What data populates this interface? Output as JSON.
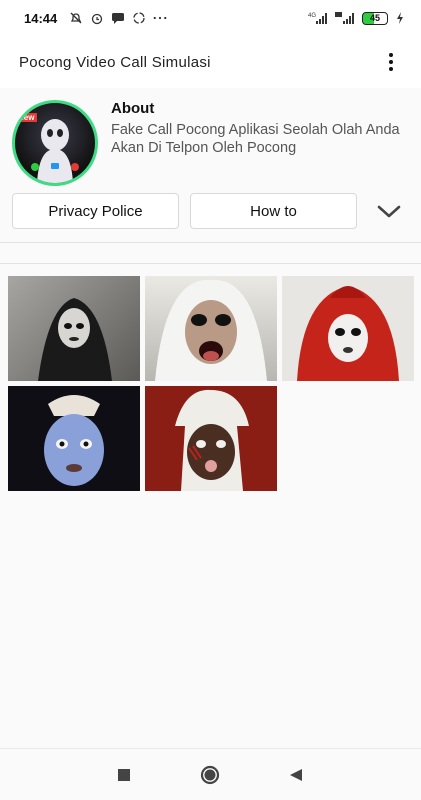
{
  "status": {
    "time": "14:44",
    "battery": "45",
    "network_label": "4G"
  },
  "appbar": {
    "title": "Pocong Video Call Simulasi",
    "menu_icon": "kebab-menu-icon"
  },
  "about": {
    "title": "About",
    "description": "Fake Call Pocong Aplikasi Seolah Olah Anda Akan Di Telpon Oleh Pocong",
    "avatar_badge": "New"
  },
  "buttons": {
    "privacy": "Privacy Police",
    "howto": "How to",
    "expand_icon": "chevron-down-icon"
  },
  "gallery": {
    "items": [
      {
        "name": "pocong-video-1",
        "bg": "#8c8a86"
      },
      {
        "name": "pocong-video-2",
        "bg": "#d9d7d2"
      },
      {
        "name": "pocong-video-3",
        "bg": "#b51d14"
      },
      {
        "name": "pocong-video-4",
        "bg": "#1a1a26"
      },
      {
        "name": "pocong-video-5",
        "bg": "#7a1a12"
      }
    ]
  },
  "colors": {
    "avatar_ring": "#3ddc84",
    "battery_fill": "#2ecc40"
  },
  "navbar": {
    "recents_icon": "square-recents-icon",
    "home_icon": "circle-home-icon",
    "back_icon": "triangle-back-icon"
  }
}
